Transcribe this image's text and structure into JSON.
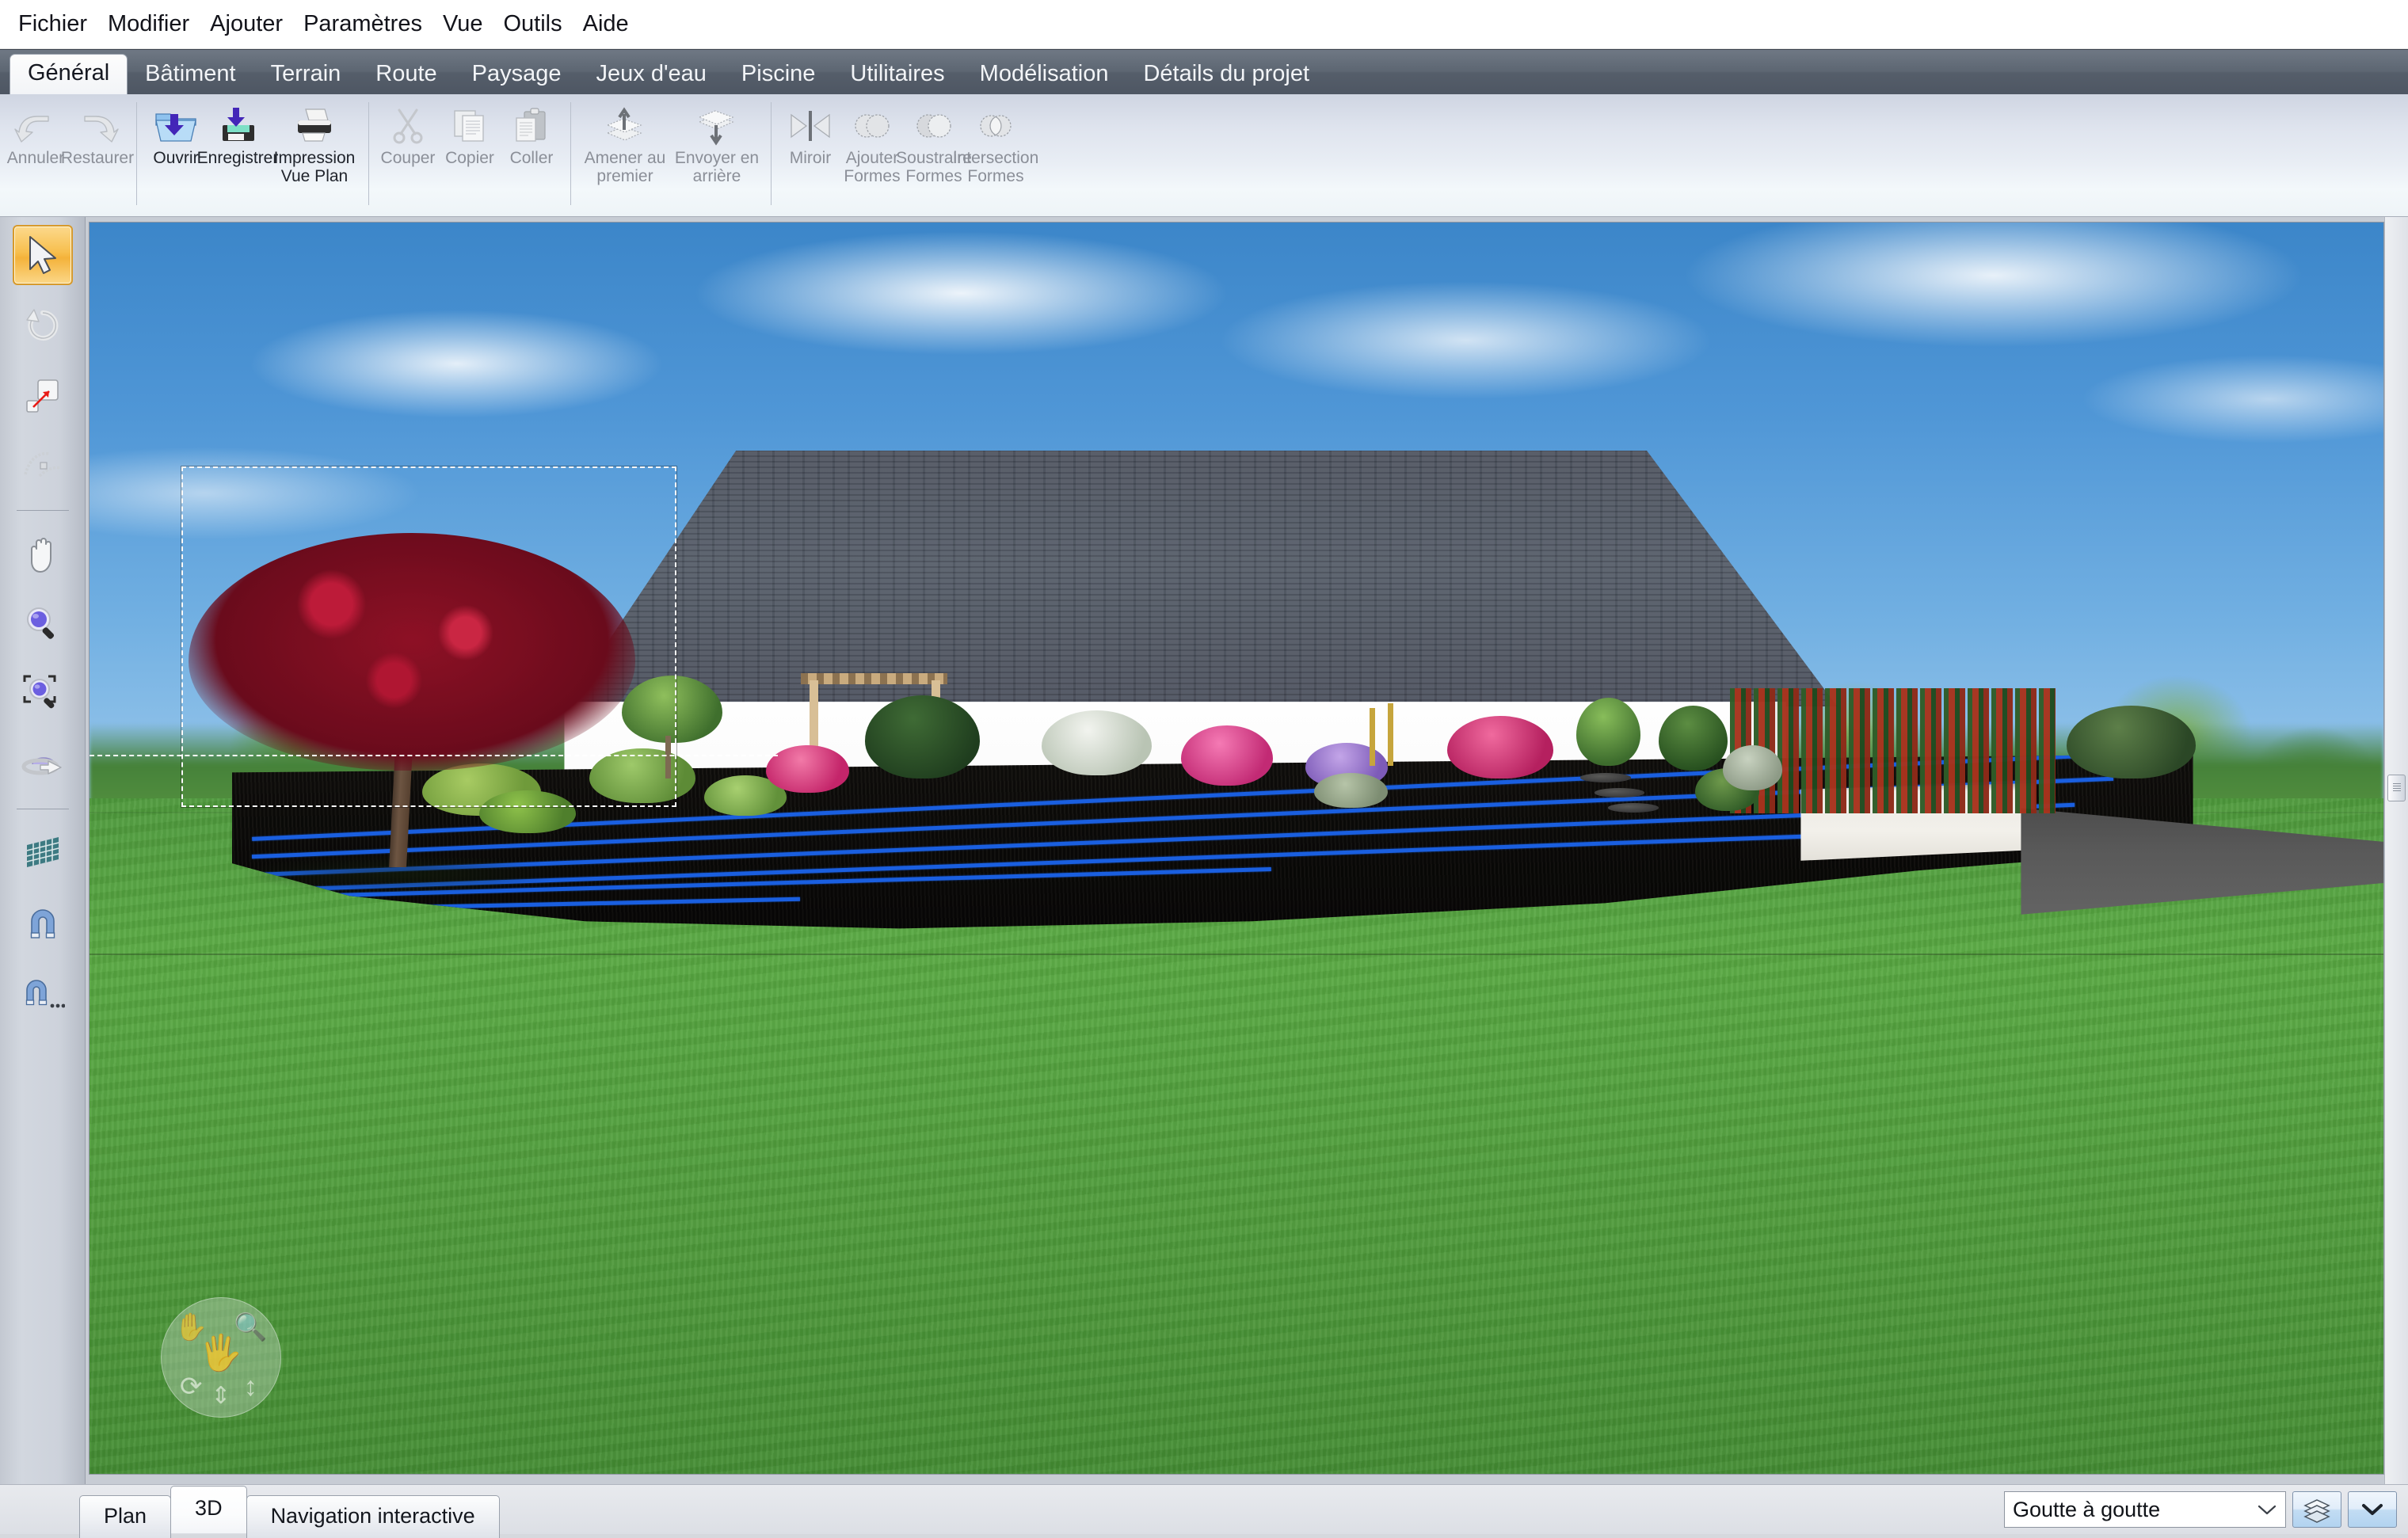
{
  "menubar": {
    "items": [
      {
        "label": "Fichier",
        "name": "menu-fichier"
      },
      {
        "label": "Modifier",
        "name": "menu-modifier"
      },
      {
        "label": "Ajouter",
        "name": "menu-ajouter"
      },
      {
        "label": "Paramètres",
        "name": "menu-parametres"
      },
      {
        "label": "Vue",
        "name": "menu-vue"
      },
      {
        "label": "Outils",
        "name": "menu-outils"
      },
      {
        "label": "Aide",
        "name": "menu-aide"
      }
    ]
  },
  "ribbon_tabs": {
    "active": "Général",
    "items": [
      {
        "label": "Général"
      },
      {
        "label": "Bâtiment"
      },
      {
        "label": "Terrain"
      },
      {
        "label": "Route"
      },
      {
        "label": "Paysage"
      },
      {
        "label": "Jeux d'eau"
      },
      {
        "label": "Piscine"
      },
      {
        "label": "Utilitaires"
      },
      {
        "label": "Modélisation"
      },
      {
        "label": "Détails du projet"
      }
    ]
  },
  "ribbon": {
    "groups": [
      {
        "name": "history",
        "buttons": [
          {
            "label": "Annuler",
            "icon": "undo-icon",
            "enabled": false
          },
          {
            "label": "Restaurer",
            "icon": "redo-icon",
            "enabled": false
          }
        ]
      },
      {
        "name": "file",
        "buttons": [
          {
            "label": "Ouvrir",
            "icon": "open-folder-icon",
            "enabled": true
          },
          {
            "label": "Enregistrer",
            "icon": "save-floppy-icon",
            "enabled": true
          },
          {
            "label": "Impression Vue Plan",
            "icon": "printer-icon",
            "enabled": true
          }
        ]
      },
      {
        "name": "clipboard",
        "buttons": [
          {
            "label": "Couper",
            "icon": "scissors-icon",
            "enabled": false
          },
          {
            "label": "Copier",
            "icon": "copy-pages-icon",
            "enabled": false
          },
          {
            "label": "Coller",
            "icon": "clipboard-paste-icon",
            "enabled": false
          }
        ]
      },
      {
        "name": "order",
        "buttons": [
          {
            "label": "Amener au premier",
            "icon": "bring-to-front-icon",
            "enabled": false
          },
          {
            "label": "Envoyer en arrière",
            "icon": "send-to-back-icon",
            "enabled": false
          }
        ]
      },
      {
        "name": "shapes",
        "buttons": [
          {
            "label": "Miroir",
            "icon": "mirror-icon",
            "enabled": false
          },
          {
            "label": "Ajouter Formes",
            "icon": "union-shapes-icon",
            "enabled": false
          },
          {
            "label": "Soustraire Formes",
            "icon": "subtract-shapes-icon",
            "enabled": false
          },
          {
            "label": "Intersection Formes",
            "icon": "intersect-shapes-icon",
            "enabled": false
          }
        ]
      }
    ]
  },
  "toolrail": {
    "tools": [
      {
        "name": "select-arrow-tool",
        "icon": "cursor-arrow-icon",
        "selected": true
      },
      {
        "name": "rotate-tool",
        "icon": "rotate-arrow-icon",
        "selected": false
      },
      {
        "name": "resize-tool",
        "icon": "resize-square-icon",
        "selected": false
      },
      {
        "name": "curve-tool",
        "icon": "curve-edit-icon",
        "selected": false
      },
      {
        "name": "pan-tool",
        "icon": "hand-icon",
        "selected": false
      },
      {
        "name": "zoom-tool",
        "icon": "magnifier-icon",
        "selected": false
      },
      {
        "name": "zoom-window-tool",
        "icon": "magnifier-window-icon",
        "selected": false
      },
      {
        "name": "orbit-tool",
        "icon": "orbit-icon",
        "selected": false
      },
      {
        "name": "grid-tool",
        "icon": "grid-icon",
        "selected": false
      },
      {
        "name": "snap-tool",
        "icon": "magnet-icon",
        "selected": false
      },
      {
        "name": "snap-options-tool",
        "icon": "magnet-options-icon",
        "selected": false
      }
    ]
  },
  "viewport": {
    "nav_wheel": {
      "name": "navigation-wheel",
      "icons": [
        "pan-hand-icon",
        "zoom-magnifier-icon",
        "orbit-icon",
        "walk-arrow-icon"
      ]
    },
    "selection": {
      "visible": true,
      "target": "red-ornamental-tree"
    },
    "scene": {
      "sky_color": "#4f96d6",
      "lawn_color": "#52a03d",
      "roof_color": "#4d535f",
      "wall_color": "#fefefe",
      "mulch_color": "#0d0c0a",
      "drip_line_color": "#1a5fe0"
    }
  },
  "statusbar": {
    "view_tabs": [
      {
        "label": "Plan",
        "active": false
      },
      {
        "label": "3D",
        "active": true
      },
      {
        "label": "Navigation interactive",
        "active": false
      }
    ],
    "layer_select": {
      "value": "Goutte à goutte",
      "arrow": "chevron-down-icon"
    },
    "layers_button": {
      "name": "layers-button",
      "icon": "layers-stack-icon"
    },
    "dropdown_button": {
      "name": "more-options-button",
      "icon": "chevron-down-icon"
    }
  }
}
